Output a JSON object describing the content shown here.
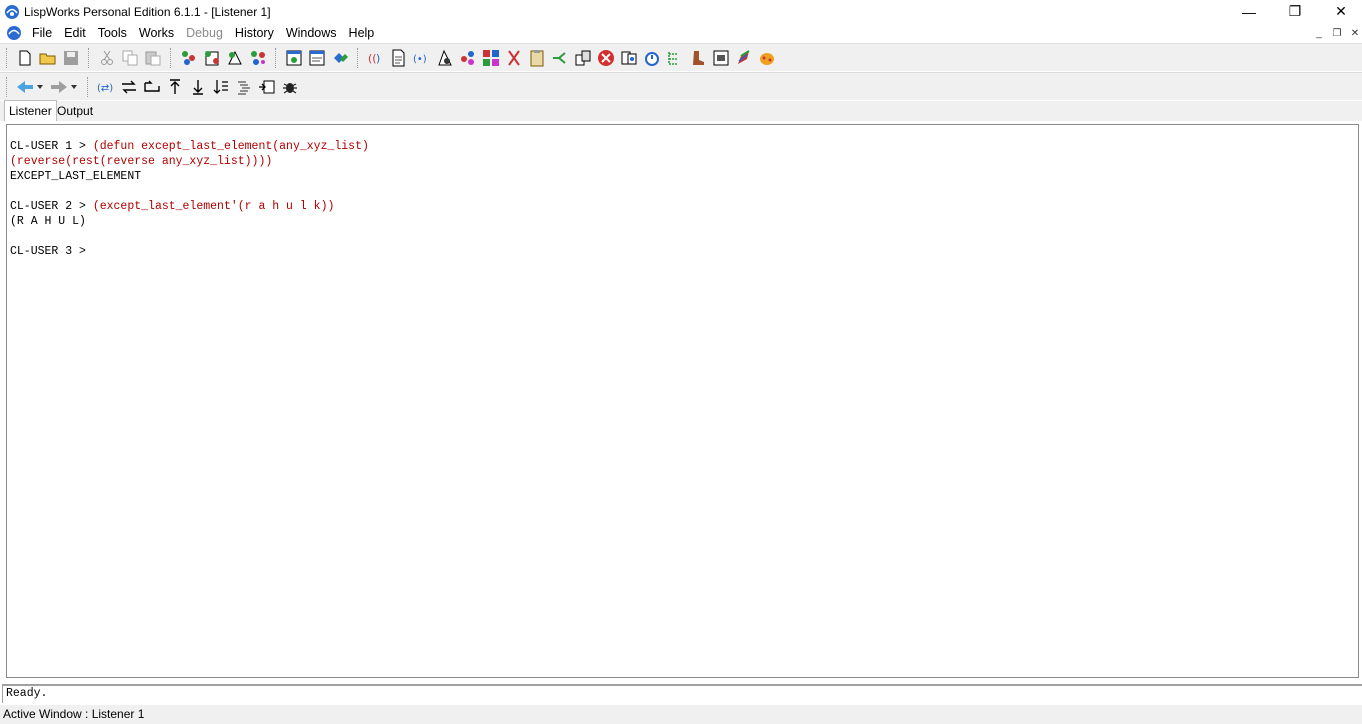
{
  "window": {
    "title": "LispWorks Personal Edition 6.1.1 - [Listener 1]",
    "minimize_glyph": "—",
    "restore_glyph": "❐",
    "close_glyph": "✕"
  },
  "menu": {
    "items": [
      "File",
      "Edit",
      "Tools",
      "Works",
      "Debug",
      "History",
      "Windows",
      "Help"
    ],
    "mdi_min": "_",
    "mdi_restore": "❐",
    "mdi_close": "✕"
  },
  "toolbar1": {
    "icons": [
      "new-file",
      "open-file",
      "save",
      "cut",
      "copy",
      "paste",
      "inspect",
      "evaluate-region",
      "compile",
      "compile-buffer",
      "listener",
      "editor",
      "tools",
      "class-browser",
      "generic-function-browser",
      "symbol-browser",
      "debugger",
      "object-clipboard",
      "output-browser",
      "profiler",
      "search-files",
      "tracer",
      "system-browser",
      "stop",
      "process-browser",
      "function-call-browser",
      "inspector",
      "walker",
      "interface-builder",
      "color",
      "lisp-logo"
    ]
  },
  "toolbar2": {
    "icons": [
      "back-arrow",
      "forward-arrow",
      "toggle-listener",
      "previous-history",
      "next-history",
      "top-of-stack",
      "bottom-of-stack",
      "sort-down",
      "list-indent",
      "backtrace",
      "bug"
    ]
  },
  "tabs": [
    "Listener",
    "Output"
  ],
  "listener": {
    "line1_prompt": "CL-USER 1 > ",
    "line1_input": "(defun except_last_element(any_xyz_list)",
    "line2_input": "(reverse(rest(reverse any_xyz_list))))",
    "line3_output": "EXCEPT_LAST_ELEMENT",
    "line5_prompt": "CL-USER 2 > ",
    "line5_input": "(except_last_element'(r a h u l k))",
    "line6_output": "(R A H U L)",
    "line8_prompt": "CL-USER 3 > "
  },
  "echo_area": "Ready.",
  "status_bar": "Active Window : Listener 1",
  "colors": {
    "input_text": "#b00000",
    "chrome": "#f0f0f0",
    "accent_blue": "#2a6bd1"
  }
}
